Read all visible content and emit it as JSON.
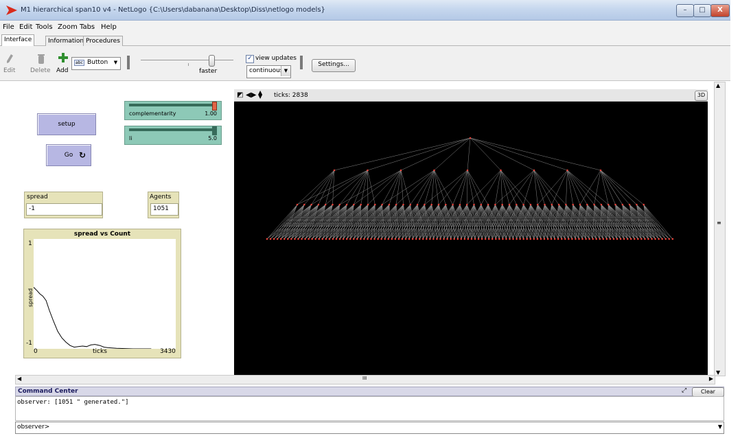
{
  "window": {
    "title": "M1 hierarchical span10 v4 - NetLogo {C:\\Users\\dabanana\\Desktop\\Diss\\netlogo models}",
    "minimize": "–",
    "maximize": "□",
    "close": "X"
  },
  "menu": [
    "File",
    "Edit",
    "Tools",
    "Zoom",
    "Tabs",
    "Help"
  ],
  "tabs": [
    "Interface",
    "Information",
    "Procedures"
  ],
  "toolbar": {
    "edit": "Edit",
    "delete": "Delete",
    "add": "Add",
    "widget_type": "Button",
    "widget_badge": "abc",
    "speed_label": "faster",
    "view_updates_label": "view updates",
    "update_mode": "continuous",
    "settings": "Settings..."
  },
  "widgets": {
    "setup_label": "setup",
    "go_label": "Go",
    "slider1": {
      "name": "complementarity",
      "value": "1.00",
      "fraction": 1.0
    },
    "slider2": {
      "name": "li",
      "value": "5.0",
      "fraction": 1.0
    },
    "monitor_spread": {
      "label": "spread",
      "value": "-1"
    },
    "monitor_agents": {
      "label": "Agents",
      "value": "1051"
    }
  },
  "chart_data": {
    "type": "line",
    "title": "spread vs Count",
    "xlabel": "ticks",
    "ylabel": "spread",
    "xlim": [
      0,
      3430
    ],
    "ylim": [
      -1,
      1
    ],
    "x_min_label": "0",
    "x_max_label": "3430",
    "y_max_label": "1",
    "y_min_label": "-1",
    "series": [
      {
        "color": "#000000",
        "points": [
          [
            0,
            0.12
          ],
          [
            80,
            0.06
          ],
          [
            150,
            0.0
          ],
          [
            220,
            -0.04
          ],
          [
            300,
            -0.12
          ],
          [
            380,
            -0.3
          ],
          [
            480,
            -0.5
          ],
          [
            580,
            -0.68
          ],
          [
            680,
            -0.8
          ],
          [
            780,
            -0.88
          ],
          [
            880,
            -0.94
          ],
          [
            980,
            -0.97
          ],
          [
            1080,
            -0.96
          ],
          [
            1180,
            -0.95
          ],
          [
            1280,
            -0.96
          ],
          [
            1380,
            -0.93
          ],
          [
            1480,
            -0.92
          ],
          [
            1600,
            -0.94
          ],
          [
            1700,
            -0.97
          ],
          [
            1800,
            -0.98
          ],
          [
            2000,
            -0.99
          ],
          [
            2400,
            -1.0
          ],
          [
            2838,
            -1.0
          ]
        ]
      }
    ]
  },
  "view": {
    "ticks_label": "ticks: 2838",
    "btn_3d": "3D"
  },
  "hscroll_label": "III",
  "command_center": {
    "title": "Command Center",
    "clear": "Clear",
    "output": "observer: [1051 \" generated.\"]",
    "prompt": "observer>"
  }
}
